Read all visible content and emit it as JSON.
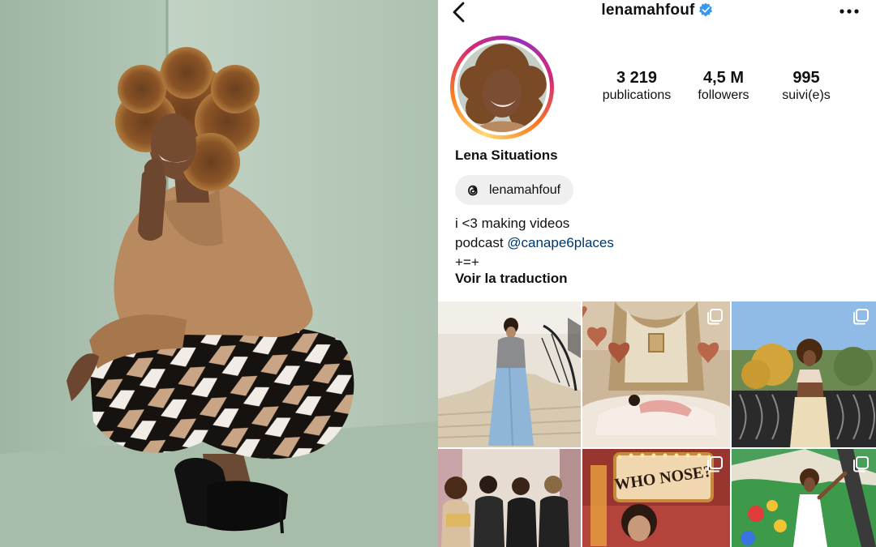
{
  "profile": {
    "username": "lenamahfouf",
    "verified": true,
    "display_name": "Lena Situations",
    "threads_handle": "lenamahfouf",
    "bio": {
      "line1": "i <3 making videos",
      "line2_prefix": "podcast ",
      "line2_mention": "@canape6places",
      "line3": "+=+"
    },
    "translate_label": "Voir la traduction"
  },
  "stats": {
    "posts": {
      "value": "3 219",
      "label": "publications"
    },
    "followers": {
      "value": "4,5 M",
      "label": "followers"
    },
    "following": {
      "value": "995",
      "label": "suivi(e)s"
    }
  },
  "posts_grid": {
    "tile_1": {
      "carousel": false
    },
    "tile_2": {
      "carousel": true
    },
    "tile_3": {
      "carousel": true
    },
    "tile_4": {
      "carousel": false
    },
    "tile_5": {
      "carousel": true,
      "sign_text": "WHO NOSE?"
    },
    "tile_6": {
      "carousel": true
    }
  },
  "icons": {
    "back": "chevron-left-icon",
    "verified": "verified-badge-icon",
    "more": "more-options-icon",
    "threads": "threads-icon",
    "carousel": "carousel-icon"
  },
  "colors": {
    "verified_blue": "#3897f0",
    "mention_blue": "#00376b",
    "story_ring": [
      "#feda75",
      "#fa7e1e",
      "#d62976",
      "#962fbf"
    ]
  }
}
